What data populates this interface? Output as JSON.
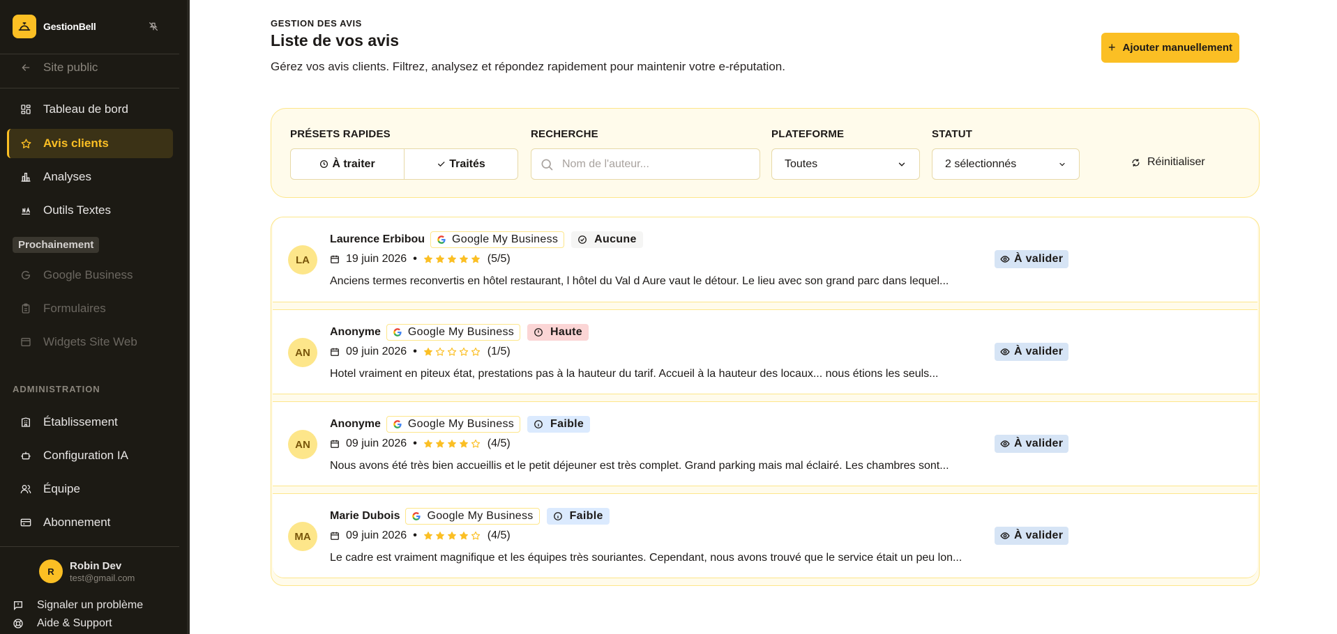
{
  "app": {
    "name": "GestionBell",
    "accent": "#fbbf24",
    "sidebar_bg": "#1c1a14"
  },
  "sidebar": {
    "public_site": {
      "label": "Site public",
      "icon": "arrow-left-icon"
    },
    "main_items": [
      {
        "label": "Tableau de bord",
        "icon": "dashboard-icon"
      },
      {
        "label": "Avis clients",
        "icon": "star-icon",
        "active": true
      },
      {
        "label": "Analyses",
        "icon": "bar-chart-icon"
      },
      {
        "label": "Outils Textes",
        "icon": "text-tools-icon"
      }
    ],
    "soon_label": "Prochainement",
    "soon_items": [
      {
        "label": "Google Business",
        "icon": "google-icon"
      },
      {
        "label": "Formulaires",
        "icon": "clipboard-icon"
      },
      {
        "label": "Widgets Site Web",
        "icon": "widget-icon"
      }
    ],
    "admin_label": "ADMINISTRATION",
    "admin_items": [
      {
        "label": "Établissement",
        "icon": "building-icon"
      },
      {
        "label": "Configuration IA",
        "icon": "robot-icon"
      },
      {
        "label": "Équipe",
        "icon": "team-icon"
      },
      {
        "label": "Abonnement",
        "icon": "credit-card-icon"
      }
    ],
    "user": {
      "initial": "R",
      "name": "Robin Dev",
      "email": "test@gmail.com"
    },
    "footer": [
      {
        "label": "Signaler un problème",
        "icon": "report-icon"
      },
      {
        "label": "Aide & Support",
        "icon": "lifebuoy-icon"
      }
    ]
  },
  "header": {
    "kicker": "GESTION DES AVIS",
    "title": "Liste de vos avis",
    "description": "Gérez vos avis clients. Filtrez, analysez et répondez rapidement pour maintenir votre e-réputation.",
    "add_button": "Ajouter manuellement"
  },
  "filters": {
    "presets_label": "PRÉSETS RAPIDES",
    "presets": [
      "À traiter",
      "Traités"
    ],
    "search_label": "RECHERCHE",
    "search_placeholder": "Nom de l'auteur...",
    "platform_label": "PLATEFORME",
    "platform_value": "Toutes",
    "status_label": "STATUT",
    "status_value": "2 sélectionnés",
    "reset_label": "Réinitialiser"
  },
  "reviews": [
    {
      "initials": "LA",
      "author": "Laurence Erbibou",
      "platform": "Google My Business",
      "priority": "Aucune",
      "priority_kind": "none",
      "date": "19 juin 2026",
      "rating": 5,
      "rating_label": "(5/5)",
      "text": "Anciens termes reconvertis en hôtel restaurant, l hôtel du Val d Aure vaut le détour. Le lieu avec son grand parc dans lequel...",
      "status": "À valider"
    },
    {
      "initials": "AN",
      "author": "Anonyme",
      "platform": "Google My Business",
      "priority": "Haute",
      "priority_kind": "high",
      "date": "09 juin 2026",
      "rating": 1,
      "rating_label": "(1/5)",
      "text": "Hotel vraiment en piteux état, prestations pas à la hauteur du tarif. Accueil à la hauteur des locaux... nous étions les seuls...",
      "status": "À valider"
    },
    {
      "initials": "AN",
      "author": "Anonyme",
      "platform": "Google My Business",
      "priority": "Faible",
      "priority_kind": "low",
      "date": "09 juin 2026",
      "rating": 4,
      "rating_label": "(4/5)",
      "text": "Nous avons été très bien accueillis et le petit déjeuner est très complet. Grand parking mais mal éclairé. Les chambres sont...",
      "status": "À valider"
    },
    {
      "initials": "MA",
      "author": "Marie Dubois",
      "platform": "Google My Business",
      "priority": "Faible",
      "priority_kind": "low",
      "date": "09 juin 2026",
      "rating": 4,
      "rating_label": "(4/5)",
      "text": "Le cadre est vraiment magnifique et les équipes très souriantes. Cependant, nous avons trouvé que le service était un peu lon...",
      "status": "À valider"
    }
  ]
}
